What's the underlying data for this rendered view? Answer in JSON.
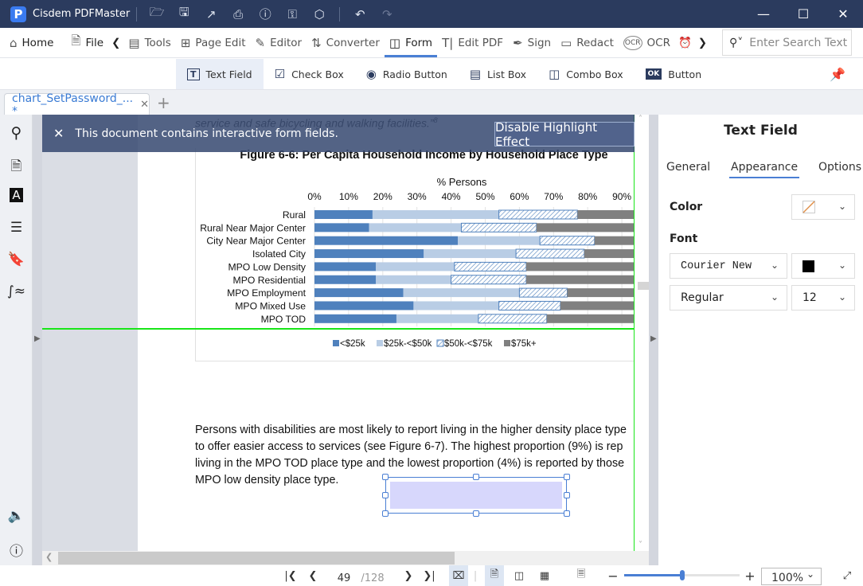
{
  "app": {
    "title": "Cisdem PDFMaster",
    "logo_letter": "P"
  },
  "titlebar_icons": [
    "open-folder-icon",
    "save-icon",
    "share-icon",
    "print-icon",
    "help-icon",
    "key-icon",
    "settings-icon",
    "undo-icon",
    "redo-icon"
  ],
  "main_toolbar": {
    "items": [
      {
        "label": "Home",
        "icon": "home-icon"
      },
      {
        "label": "File",
        "icon": "file-icon"
      },
      {
        "label": "Tools",
        "icon": "toolbox-icon"
      },
      {
        "label": "Page Edit",
        "icon": "grid-icon"
      },
      {
        "label": "Editor",
        "icon": "edit-icon"
      },
      {
        "label": "Converter",
        "icon": "convert-icon"
      },
      {
        "label": "Form",
        "icon": "form-icon",
        "active": true
      },
      {
        "label": "Edit PDF",
        "icon": "text-cursor-icon"
      },
      {
        "label": "Sign",
        "icon": "pen-icon"
      },
      {
        "label": "Redact",
        "icon": "redact-icon"
      },
      {
        "label": "OCR",
        "icon": "ocr-icon"
      }
    ],
    "search_placeholder": "Enter Search Text"
  },
  "form_toolbar": {
    "items": [
      {
        "label": "Text Field",
        "active": true
      },
      {
        "label": "Check Box"
      },
      {
        "label": "Radio Button"
      },
      {
        "label": "List Box"
      },
      {
        "label": "Combo Box"
      },
      {
        "label": "Button",
        "badge": "OK"
      }
    ]
  },
  "tabs": {
    "doc_tab": "chart_SetPassword_... *",
    "close": "✕",
    "add": "+"
  },
  "banner": {
    "message": "This document contains interactive form fields.",
    "button": "Disable Highlight Effect"
  },
  "document": {
    "quote_line": "service and safe bicycling and walking facilities.”",
    "footnote": "8",
    "paragraph": [
      "Persons with disabilities are most likely to report living in the higher density place type",
      "to offer easier access to services (see Figure 6-7). The highest proportion (9%) is rep",
      "living in the MPO TOD place type and the lowest proportion (4%) is reported by those",
      "MPO low density place type."
    ]
  },
  "chart_data": {
    "type": "bar",
    "orientation": "horizontal",
    "stacked": true,
    "title": "Figure 6-6:  Per Capita Household Income by Household Place Type",
    "xlabel": "% Persons",
    "ylabel": "",
    "xlim": [
      0,
      100
    ],
    "x_ticks": [
      "0%",
      "10%",
      "20%",
      "30%",
      "40%",
      "50%",
      "60%",
      "70%",
      "80%",
      "90%"
    ],
    "grid": true,
    "legend_position": "bottom",
    "categories": [
      "Rural",
      "Rural Near Major Center",
      "City Near Major Center",
      "Isolated City",
      "MPO Low Density",
      "MPO Residential",
      "MPO Employment",
      "MPO Mixed Use",
      "MPO TOD"
    ],
    "series": [
      {
        "name": "<$25k",
        "color": "#4f81bd",
        "values": [
          17,
          16,
          42,
          32,
          18,
          18,
          26,
          29,
          24
        ]
      },
      {
        "name": "$25k-<$50k",
        "color": "#b9cde5",
        "values": [
          37,
          27,
          24,
          27,
          23,
          22,
          34,
          25,
          24
        ]
      },
      {
        "name": "$50k-<$75k",
        "color": "#ffffff",
        "pattern": "hatch",
        "values": [
          23,
          22,
          16,
          20,
          21,
          22,
          14,
          18,
          20
        ]
      },
      {
        "name": "$75k+",
        "color": "#808080",
        "values": [
          23,
          35,
          18,
          21,
          38,
          38,
          26,
          28,
          32
        ]
      }
    ]
  },
  "right_panel": {
    "title": "Text Field",
    "tabs": [
      "General",
      "Appearance",
      "Options"
    ],
    "active_tab": "Appearance",
    "color_label": "Color",
    "color_value": "none",
    "font_label": "Font",
    "font_family": "Courier New",
    "font_color": "#000000",
    "font_style": "Regular",
    "font_size": "12"
  },
  "statusbar": {
    "current_page": "49",
    "total_pages": "/128",
    "zoom": "100%",
    "zoom_fraction": 0.5
  }
}
